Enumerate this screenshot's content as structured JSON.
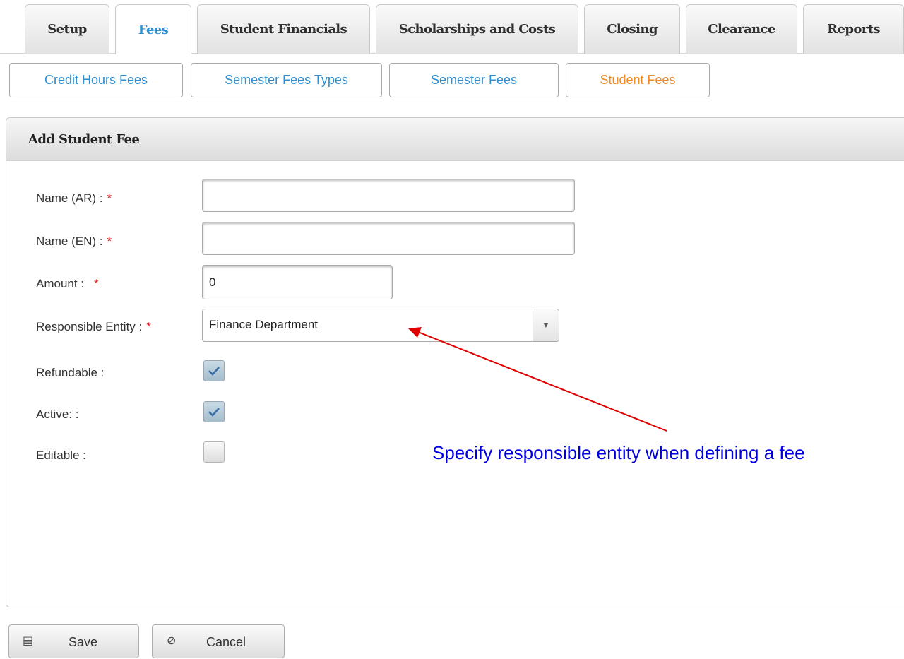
{
  "main_tabs": [
    "Setup",
    "Fees",
    "Student Financials",
    "Scholarships and Costs",
    "Closing",
    "Clearance",
    "Reports"
  ],
  "active_main_tab": "Fees",
  "sub_tabs": [
    "Credit Hours Fees",
    "Semester Fees Types",
    "Semester Fees",
    "Student Fees"
  ],
  "active_sub_tab": "Student Fees",
  "form": {
    "title": "Add Student Fee",
    "required_marker": "*",
    "name_ar_label": "Name (AR) :",
    "name_ar_value": "",
    "name_en_label": "Name (EN) :",
    "name_en_value": "",
    "amount_label": "Amount :",
    "amount_value": "0",
    "entity_label": "Responsible Entity :",
    "entity_value": "Finance Department",
    "refundable_label": "Refundable :",
    "refundable_checked": true,
    "active_label": "Active: :",
    "active_checked": true,
    "editable_label": "Editable :",
    "editable_checked": false
  },
  "annotation": "Specify responsible entity when defining a fee",
  "buttons": {
    "save": "Save",
    "cancel": "Cancel"
  },
  "colors": {
    "active_tab": "#2e8ed0",
    "active_sub_tab": "#f08a24",
    "required": "#e02222",
    "annotation": "#0000e0",
    "arrow": "#e00000"
  }
}
